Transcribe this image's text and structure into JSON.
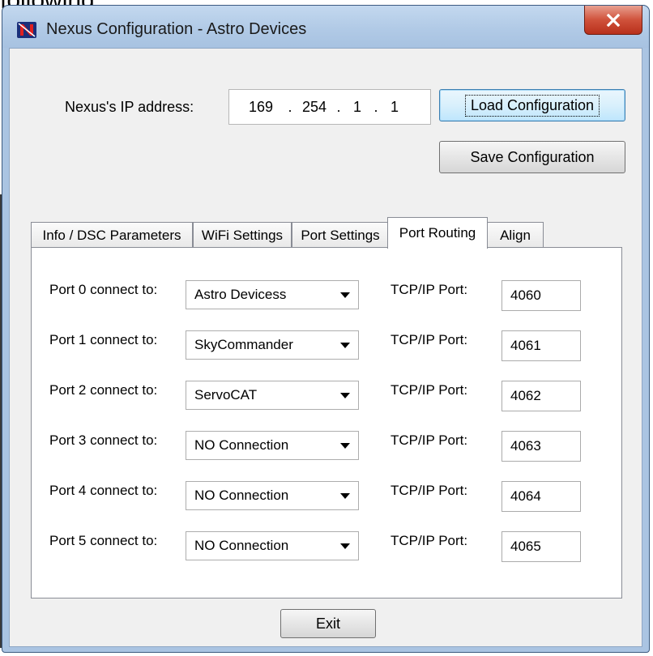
{
  "background_text": "following:",
  "window": {
    "title": "Nexus Configuration - Astro Devices",
    "app_icon": "nexus-app-icon",
    "close_icon": "close-x-icon",
    "close_color": "#c9462c"
  },
  "ip": {
    "label": "Nexus's IP address:",
    "octets": [
      "169",
      "254",
      "1",
      "1"
    ],
    "separator": "."
  },
  "buttons": {
    "load": "Load Configuration",
    "save": "Save Configuration",
    "exit": "Exit"
  },
  "tabs": [
    {
      "label": "Info / DSC Parameters",
      "active": false
    },
    {
      "label": "WiFi Settings",
      "active": false
    },
    {
      "label": "Port Settings",
      "active": false
    },
    {
      "label": "Port Routing",
      "active": true
    },
    {
      "label": "Align",
      "active": false
    }
  ],
  "routing": {
    "tcp_label": "TCP/IP Port:",
    "rows": [
      {
        "label": "Port 0 connect to:",
        "device": "Astro Devicess",
        "tcp_port": "4060"
      },
      {
        "label": "Port 1 connect to:",
        "device": "SkyCommander",
        "tcp_port": "4061"
      },
      {
        "label": "Port 2 connect to:",
        "device": "ServoCAT",
        "tcp_port": "4062"
      },
      {
        "label": "Port 3 connect to:",
        "device": "NO Connection",
        "tcp_port": "4063"
      },
      {
        "label": "Port 4 connect to:",
        "device": "NO Connection",
        "tcp_port": "4064"
      },
      {
        "label": "Port 5 connect to:",
        "device": "NO Connection",
        "tcp_port": "4065"
      }
    ]
  }
}
